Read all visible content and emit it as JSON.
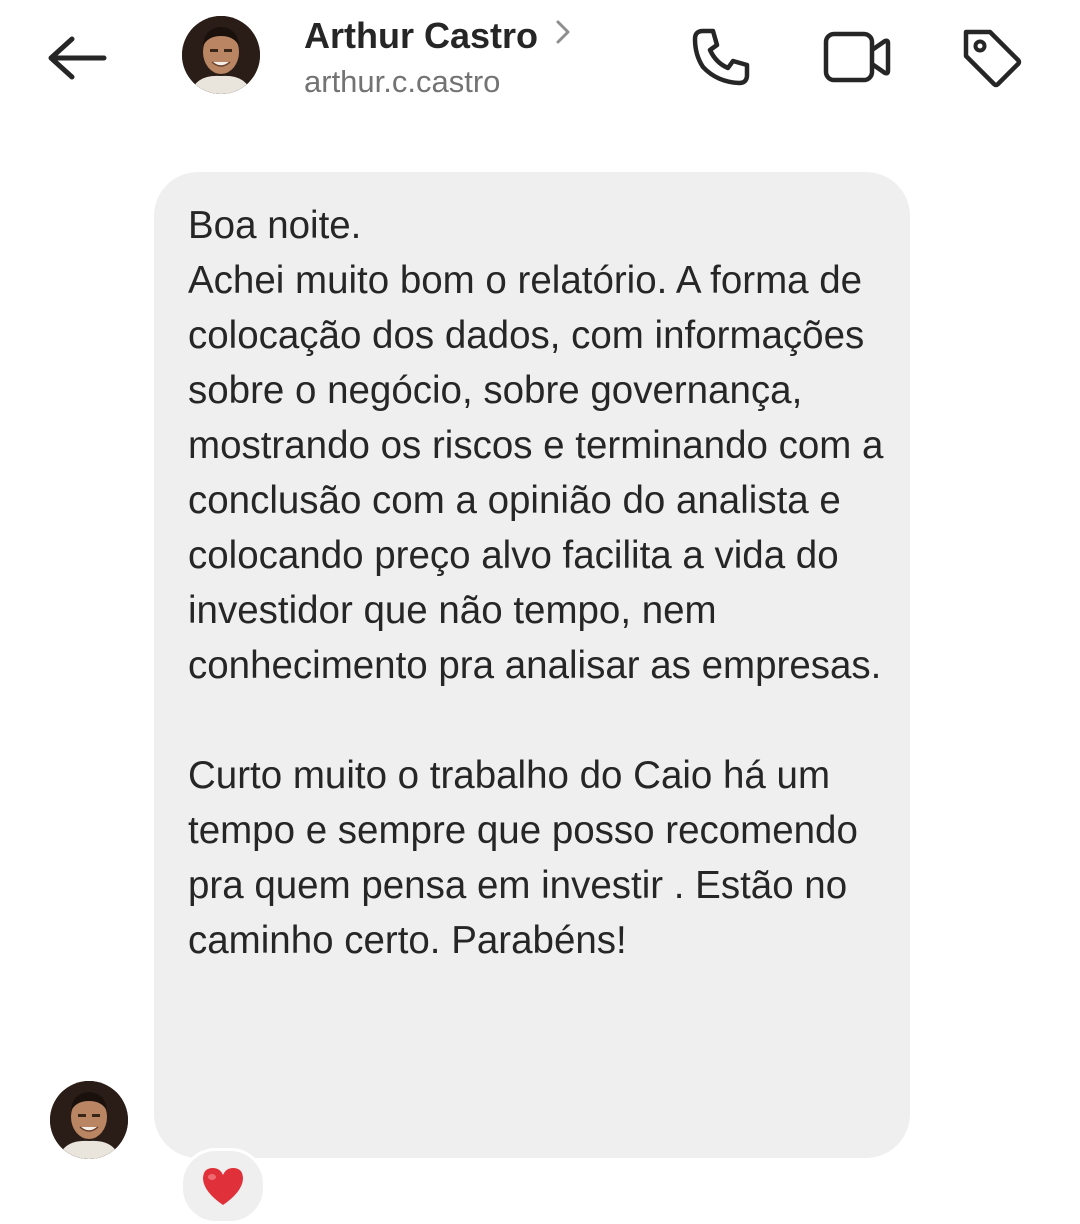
{
  "header": {
    "back_icon": "arrow-left-icon",
    "contact_name": "Arthur Castro",
    "contact_handle": "arthur.c.castro",
    "call_icon": "phone-icon",
    "video_icon": "video-camera-icon",
    "tag_icon": "tag-icon"
  },
  "message": {
    "text": "Boa noite.\nAchei muito bom o relatório. A forma de colocação dos dados, com informações sobre o negócio, sobre governança, mostrando os riscos e terminando com a conclusão com a opinião do analista e colocando preço alvo facilita a vida do investidor que não tempo, nem conhecimento pra analisar as empresas.\n\nCurto muito o trabalho do Caio há um tempo e sempre que posso recomendo pra quem pensa em investir . Estão no caminho certo. Parabéns!",
    "reaction": "❤️"
  },
  "colors": {
    "bubble": "#efefef",
    "text": "#262626",
    "secondary_text": "#737373",
    "reaction_heart": "#e0303a"
  }
}
